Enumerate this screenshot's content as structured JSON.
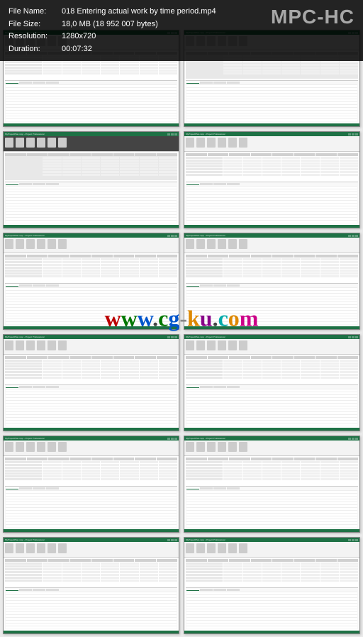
{
  "player": {
    "app_title": "MPC-HC",
    "info": {
      "file_name_label": "File Name:",
      "file_name": "018 Entering actual work by time period.mp4",
      "file_size_label": "File Size:",
      "file_size": "18,0 MB (18 952 007 bytes)",
      "resolution_label": "Resolution:",
      "resolution": "1280x720",
      "duration_label": "Duration:",
      "duration": "00:07:32"
    }
  },
  "watermark": {
    "text": "www.cg-ku.com"
  },
  "thumbnails": [
    {
      "title": "MyProjectPlan.mpp - Project Professional",
      "ribbon_style": "light",
      "content_style": "light"
    },
    {
      "title": "MyProjectPlan.mpp - Project Professional",
      "ribbon_style": "light",
      "content_style": "shaded"
    },
    {
      "title": "MyProjectPlan.mpp - Project Professional",
      "ribbon_style": "dark",
      "content_style": "shaded"
    },
    {
      "title": "MyProjectPlan.mpp - Project Professional",
      "ribbon_style": "light",
      "content_style": "light"
    },
    {
      "title": "MyProjectPlan.mpp - Project Professional",
      "ribbon_style": "light",
      "content_style": "light"
    },
    {
      "title": "MyProjectPlan.mpp - Project Professional",
      "ribbon_style": "light",
      "content_style": "light"
    },
    {
      "title": "MyProjectPlan.mpp - Project Professional",
      "ribbon_style": "light",
      "content_style": "light"
    },
    {
      "title": "MyProjectPlan.mpp - Project Professional",
      "ribbon_style": "light",
      "content_style": "light"
    },
    {
      "title": "MyProjectPlan.mpp - Project Professional",
      "ribbon_style": "light",
      "content_style": "light"
    },
    {
      "title": "MyProjectPlan.mpp - Project Professional",
      "ribbon_style": "light",
      "content_style": "light"
    },
    {
      "title": "MyProjectPlan.mpp - Project Professional",
      "ribbon_style": "light",
      "content_style": "light"
    },
    {
      "title": "MyProjectPlan.mpp - Project Professional",
      "ribbon_style": "light",
      "content_style": "light"
    }
  ]
}
